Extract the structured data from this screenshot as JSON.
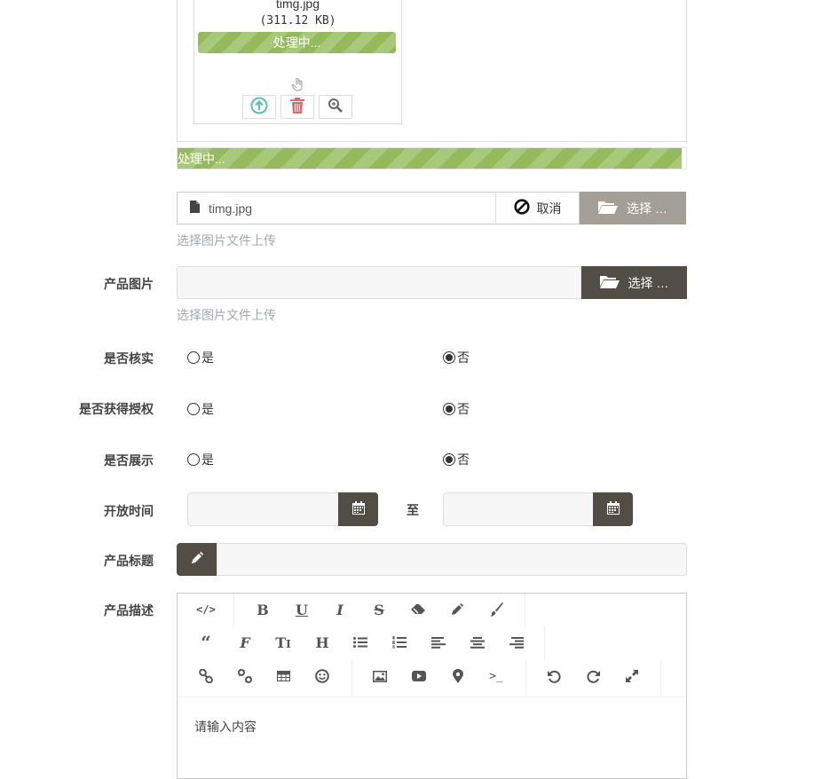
{
  "thumbnail": {
    "file_name": "timg.jpg",
    "file_size": "(311.12 KB)",
    "progress_text": "处理中...",
    "upload_icon": "upload-icon",
    "delete_icon": "trash-icon",
    "zoom_icon": "zoom-icon",
    "drag_icon": "hand-drag-icon"
  },
  "upload": {
    "progress_text": "处理中...",
    "file_value": "timg.jpg",
    "cancel_label": "取消",
    "select_label": "选择 …",
    "help_text": "选择图片文件上传"
  },
  "product_image": {
    "label": "产品图片",
    "value": "",
    "select_label": "选择 …",
    "help_text": "选择图片文件上传"
  },
  "radios": [
    {
      "label": "是否核实",
      "yes": "是",
      "no": "否",
      "selected": "no"
    },
    {
      "label": "是否获得授权",
      "yes": "是",
      "no": "否",
      "selected": "no"
    },
    {
      "label": "是否展示",
      "yes": "是",
      "no": "否",
      "selected": "no"
    }
  ],
  "open_time": {
    "label": "开放时间",
    "to_label": "至",
    "start_value": "",
    "end_value": ""
  },
  "product_title": {
    "label": "产品标题",
    "value": ""
  },
  "description": {
    "label": "产品描述",
    "placeholder": "请输入内容",
    "toolbar_rows": [
      [
        "code",
        "bold",
        "underline",
        "italic",
        "strikethrough",
        "eraser",
        "pencil",
        "brush"
      ],
      [
        "quote",
        "font",
        "font-size",
        "header",
        "list-ul",
        "list-ol",
        "align-left",
        "align-center",
        "align-right"
      ],
      [
        "link",
        "unlink",
        "table",
        "emoji",
        "image",
        "video",
        "location",
        "terminal",
        "undo",
        "redo",
        "fullscreen"
      ]
    ]
  },
  "colors": {
    "progress_green": "#96b95c",
    "dark_button": "#524e46",
    "select_disabled": "#a49f96",
    "help_text": "#a0a8b3"
  }
}
